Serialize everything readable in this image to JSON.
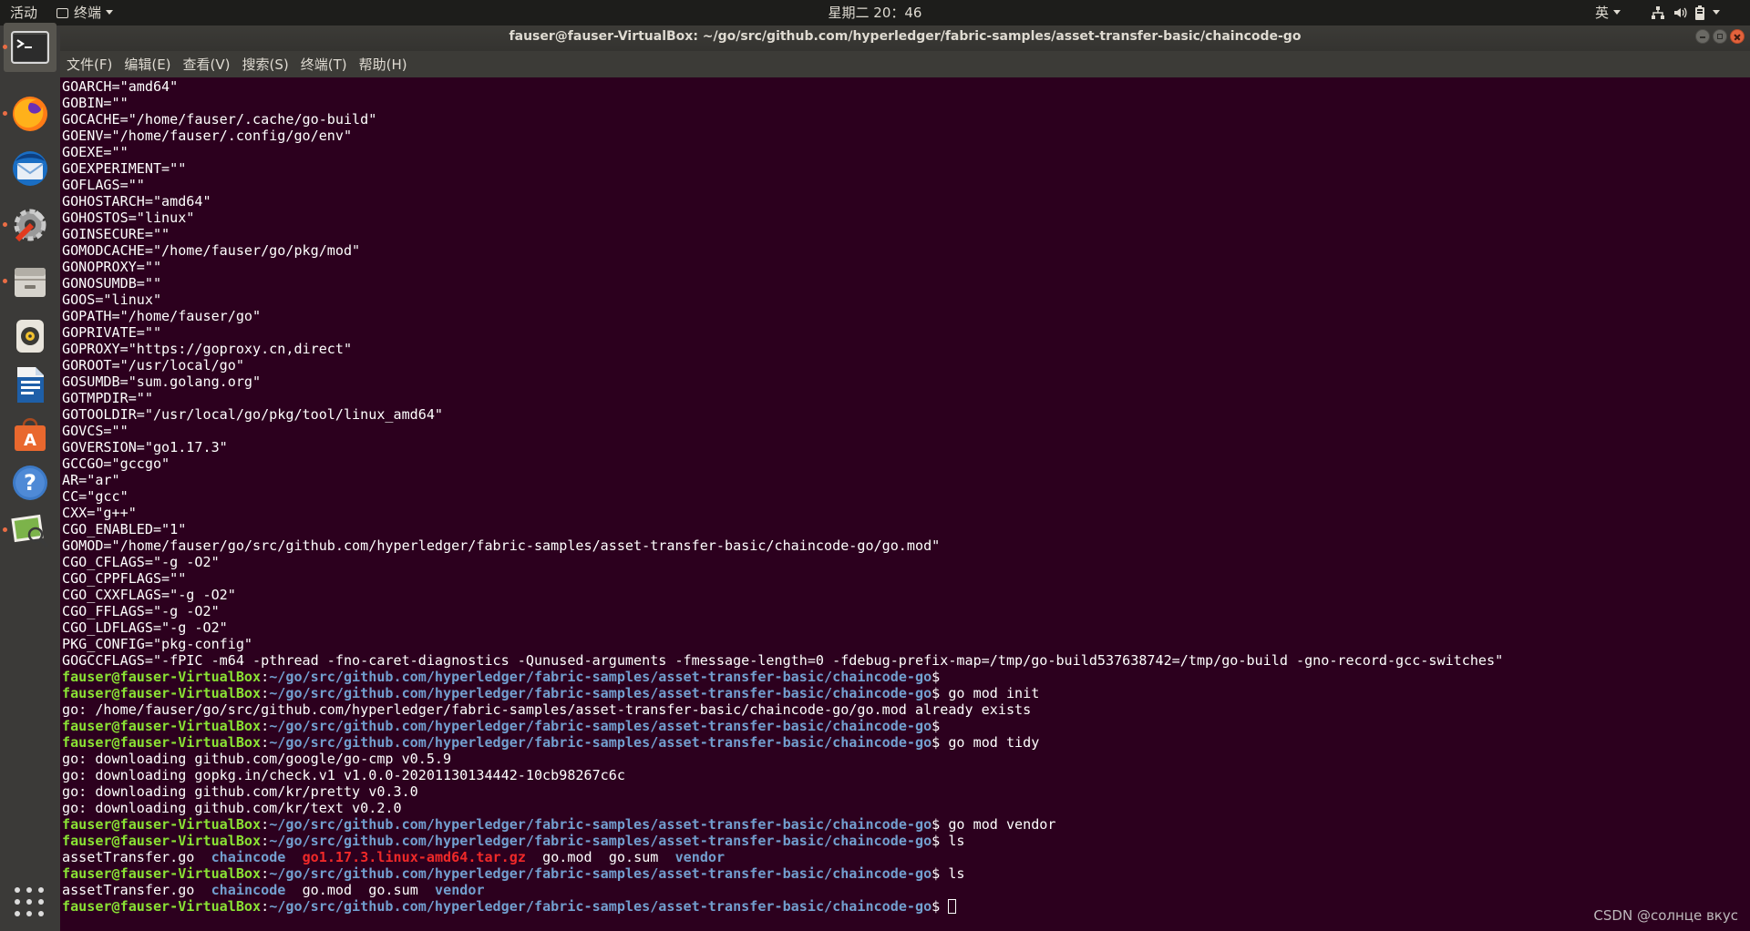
{
  "top_bar": {
    "activities": "活动",
    "app_menu_label": "终端",
    "clock": "星期二 20：46",
    "input_method": "英"
  },
  "window": {
    "title": "fauser@fauser-VirtualBox: ~/go/src/github.com/hyperledger/fabric-samples/asset-transfer-basic/chaincode-go"
  },
  "menubar": [
    "文件(F)",
    "编辑(E)",
    "查看(V)",
    "搜索(S)",
    "终端(T)",
    "帮助(H)"
  ],
  "dock": [
    {
      "name": "terminal-icon",
      "running": true
    },
    {
      "name": "firefox-icon",
      "running": true
    },
    {
      "name": "thunderbird-icon",
      "running": false
    },
    {
      "name": "settings-icon",
      "running": true
    },
    {
      "name": "files-icon",
      "running": true
    },
    {
      "name": "rhythmbox-icon",
      "running": false
    },
    {
      "name": "libreoffice-writer-icon",
      "running": false
    },
    {
      "name": "software-center-icon",
      "running": false
    },
    {
      "name": "help-icon",
      "running": false
    },
    {
      "name": "image-viewer-icon",
      "running": true
    }
  ],
  "terminal": {
    "prompt_user": "fauser@fauser-VirtualBox",
    "prompt_path": "~/go/src/github.com/hyperledger/fabric-samples/asset-transfer-basic/chaincode-go",
    "lines": [
      {
        "t": "out",
        "text": "GOARCH=\"amd64\""
      },
      {
        "t": "out",
        "text": "GOBIN=\"\""
      },
      {
        "t": "out",
        "text": "GOCACHE=\"/home/fauser/.cache/go-build\""
      },
      {
        "t": "out",
        "text": "GOENV=\"/home/fauser/.config/go/env\""
      },
      {
        "t": "out",
        "text": "GOEXE=\"\""
      },
      {
        "t": "out",
        "text": "GOEXPERIMENT=\"\""
      },
      {
        "t": "out",
        "text": "GOFLAGS=\"\""
      },
      {
        "t": "out",
        "text": "GOHOSTARCH=\"amd64\""
      },
      {
        "t": "out",
        "text": "GOHOSTOS=\"linux\""
      },
      {
        "t": "out",
        "text": "GOINSECURE=\"\""
      },
      {
        "t": "out",
        "text": "GOMODCACHE=\"/home/fauser/go/pkg/mod\""
      },
      {
        "t": "out",
        "text": "GONOPROXY=\"\""
      },
      {
        "t": "out",
        "text": "GONOSUMDB=\"\""
      },
      {
        "t": "out",
        "text": "GOOS=\"linux\""
      },
      {
        "t": "out",
        "text": "GOPATH=\"/home/fauser/go\""
      },
      {
        "t": "out",
        "text": "GOPRIVATE=\"\""
      },
      {
        "t": "out",
        "text": "GOPROXY=\"https://goproxy.cn,direct\""
      },
      {
        "t": "out",
        "text": "GOROOT=\"/usr/local/go\""
      },
      {
        "t": "out",
        "text": "GOSUMDB=\"sum.golang.org\""
      },
      {
        "t": "out",
        "text": "GOTMPDIR=\"\""
      },
      {
        "t": "out",
        "text": "GOTOOLDIR=\"/usr/local/go/pkg/tool/linux_amd64\""
      },
      {
        "t": "out",
        "text": "GOVCS=\"\""
      },
      {
        "t": "out",
        "text": "GOVERSION=\"go1.17.3\""
      },
      {
        "t": "out",
        "text": "GCCGO=\"gccgo\""
      },
      {
        "t": "out",
        "text": "AR=\"ar\""
      },
      {
        "t": "out",
        "text": "CC=\"gcc\""
      },
      {
        "t": "out",
        "text": "CXX=\"g++\""
      },
      {
        "t": "out",
        "text": "CGO_ENABLED=\"1\""
      },
      {
        "t": "out",
        "text": "GOMOD=\"/home/fauser/go/src/github.com/hyperledger/fabric-samples/asset-transfer-basic/chaincode-go/go.mod\""
      },
      {
        "t": "out",
        "text": "CGO_CFLAGS=\"-g -O2\""
      },
      {
        "t": "out",
        "text": "CGO_CPPFLAGS=\"\""
      },
      {
        "t": "out",
        "text": "CGO_CXXFLAGS=\"-g -O2\""
      },
      {
        "t": "out",
        "text": "CGO_FFLAGS=\"-g -O2\""
      },
      {
        "t": "out",
        "text": "CGO_LDFLAGS=\"-g -O2\""
      },
      {
        "t": "out",
        "text": "PKG_CONFIG=\"pkg-config\""
      },
      {
        "t": "out",
        "text": "GOGCCFLAGS=\"-fPIC -m64 -pthread -fno-caret-diagnostics -Qunused-arguments -fmessage-length=0 -fdebug-prefix-map=/tmp/go-build537638742=/tmp/go-build -gno-record-gcc-switches\""
      },
      {
        "t": "prompt",
        "cmd": ""
      },
      {
        "t": "prompt",
        "cmd": "go mod init"
      },
      {
        "t": "out",
        "text": "go: /home/fauser/go/src/github.com/hyperledger/fabric-samples/asset-transfer-basic/chaincode-go/go.mod already exists"
      },
      {
        "t": "prompt",
        "cmd": ""
      },
      {
        "t": "prompt",
        "cmd": "go mod tidy"
      },
      {
        "t": "out",
        "text": "go: downloading github.com/google/go-cmp v0.5.9"
      },
      {
        "t": "out",
        "text": "go: downloading gopkg.in/check.v1 v1.0.0-20201130134442-10cb98267c6c"
      },
      {
        "t": "out",
        "text": "go: downloading github.com/kr/pretty v0.3.0"
      },
      {
        "t": "out",
        "text": "go: downloading github.com/kr/text v0.2.0"
      },
      {
        "t": "prompt",
        "cmd": "go mod vendor"
      },
      {
        "t": "prompt",
        "cmd": "ls"
      },
      {
        "t": "ls",
        "items": [
          {
            "name": "assetTransfer.go",
            "kind": "file"
          },
          {
            "name": "chaincode",
            "kind": "dir"
          },
          {
            "name": "go1.17.3.linux-amd64.tar.gz",
            "kind": "archive"
          },
          {
            "name": "go.mod",
            "kind": "file"
          },
          {
            "name": "go.sum",
            "kind": "file"
          },
          {
            "name": "vendor",
            "kind": "dir"
          }
        ]
      },
      {
        "t": "prompt",
        "cmd": "ls"
      },
      {
        "t": "ls",
        "items": [
          {
            "name": "assetTransfer.go",
            "kind": "file"
          },
          {
            "name": "chaincode",
            "kind": "dir"
          },
          {
            "name": "go.mod",
            "kind": "file"
          },
          {
            "name": "go.sum",
            "kind": "file"
          },
          {
            "name": "vendor",
            "kind": "dir"
          }
        ]
      },
      {
        "t": "prompt",
        "cmd": "",
        "cursor": true
      }
    ]
  },
  "watermark": "CSDN @солнце вкус",
  "colors": {
    "terminal_bg": "#2c001e",
    "prompt_user": "#8ae234",
    "prompt_path": "#729fcf",
    "directory": "#729fcf",
    "archive": "#ef2929",
    "text": "#ffffff"
  }
}
